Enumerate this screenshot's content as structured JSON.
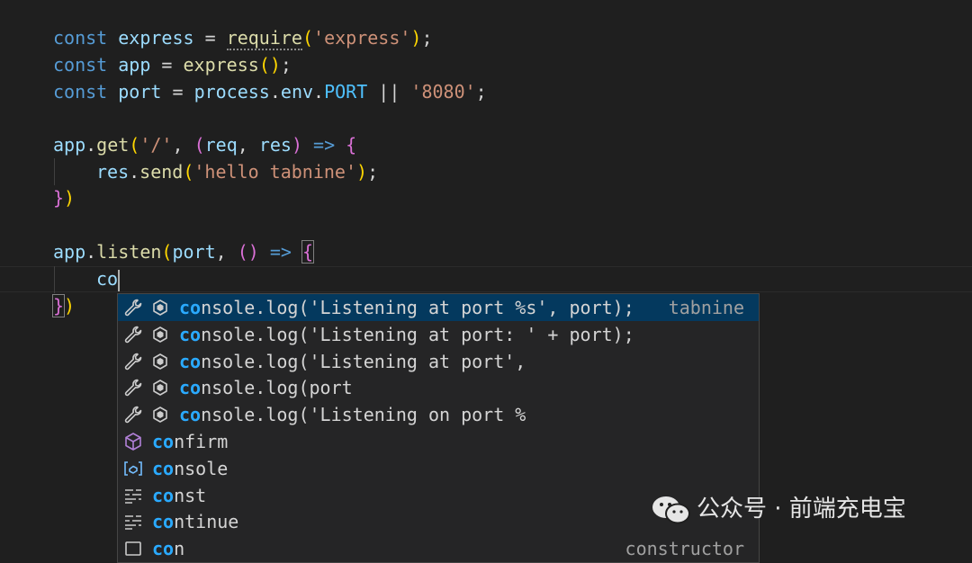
{
  "code": {
    "line1": {
      "kw": "const",
      "name": "express",
      "eq": " = ",
      "fn": "require",
      "open": "(",
      "str": "'express'",
      "close": ")",
      "end": ";"
    },
    "line2": {
      "kw": "const",
      "name": "app",
      "eq": " = ",
      "fn": "express",
      "paren": "()",
      "end": ";"
    },
    "line3": {
      "kw": "const",
      "name": "port",
      "eq": " = ",
      "obj": "process",
      "dot1": ".",
      "prop": "env",
      "dot2": ".",
      "const": "PORT",
      "or": " || ",
      "str": "'8080'",
      "end": ";"
    },
    "line5": {
      "obj": "app",
      "dot": ".",
      "fn": "get",
      "open": "(",
      "str": "'/'",
      "comma": ", ",
      "p_open": "(",
      "arg1": "req",
      "comma2": ", ",
      "arg2": "res",
      "p_close": ")",
      "arrow": " => ",
      "brace": "{"
    },
    "line6": {
      "obj": "res",
      "dot": ".",
      "fn": "send",
      "open": "(",
      "str": "'hello tabnine'",
      "close": ")",
      "end": ";"
    },
    "line7": {
      "brace": "}",
      "close": ")"
    },
    "line9": {
      "obj": "app",
      "dot": ".",
      "fn": "listen",
      "open": "(",
      "arg": "port",
      "comma": ", ",
      "p": "()",
      "arrow": " => ",
      "brace": "{"
    },
    "line10": {
      "typed": "co"
    },
    "line11": {
      "brace": "}",
      "close": ")"
    }
  },
  "suggestions": [
    {
      "icon": "wrench-icon",
      "kind": "snippet",
      "match": "co",
      "rest": "nsole.log('Listening at port %s', port);",
      "detail": "tabnine",
      "selected": true
    },
    {
      "icon": "wrench-icon",
      "kind": "snippet",
      "match": "co",
      "rest": "nsole.log('Listening at port: ' + port);",
      "detail": "",
      "selected": false
    },
    {
      "icon": "wrench-icon",
      "kind": "snippet",
      "match": "co",
      "rest": "nsole.log('Listening at port',",
      "detail": "",
      "selected": false
    },
    {
      "icon": "wrench-icon",
      "kind": "snippet",
      "match": "co",
      "rest": "nsole.log(port",
      "detail": "",
      "selected": false
    },
    {
      "icon": "wrench-icon",
      "kind": "snippet",
      "match": "co",
      "rest": "nsole.log('Listening on port %",
      "detail": "",
      "selected": false
    },
    {
      "icon": "cube-icon",
      "kind": "method",
      "match": "co",
      "rest": "nfirm",
      "detail": "",
      "selected": false
    },
    {
      "icon": "variable-icon",
      "kind": "variable",
      "match": "co",
      "rest": "nsole",
      "detail": "",
      "selected": false
    },
    {
      "icon": "keyword-icon",
      "kind": "keyword",
      "match": "co",
      "rest": "nst",
      "detail": "",
      "selected": false
    },
    {
      "icon": "keyword-icon",
      "kind": "keyword",
      "match": "co",
      "rest": "ntinue",
      "detail": "",
      "selected": false
    },
    {
      "icon": "class-icon",
      "kind": "class",
      "match": "co",
      "rest": "n",
      "detail": "constructor",
      "selected": false
    }
  ],
  "watermark": {
    "text": "公众号 · 前端充电宝",
    "icon": "wechat-icon"
  },
  "colors": {
    "selection": "#04395e",
    "match": "#2aaaff",
    "keyword": "#569cd6",
    "string": "#ce9178",
    "function": "#dcdcaa"
  }
}
